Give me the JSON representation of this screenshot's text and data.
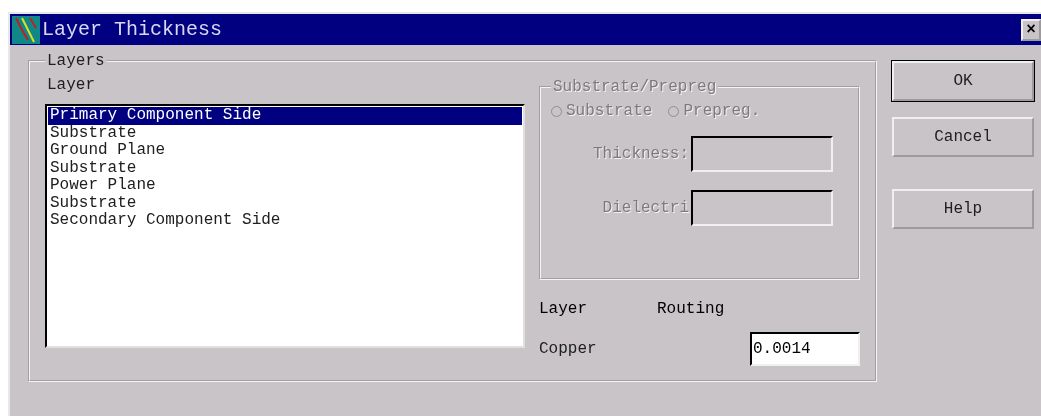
{
  "window": {
    "title": "Layer Thickness",
    "close": "×"
  },
  "layers_group": {
    "title": "Layers",
    "list_label": "Layer",
    "layers": [
      {
        "label": "Primary Component Side",
        "selected": true
      },
      {
        "label": "Substrate",
        "selected": false
      },
      {
        "label": "Ground Plane",
        "selected": false
      },
      {
        "label": "Substrate",
        "selected": false
      },
      {
        "label": "Power Plane",
        "selected": false
      },
      {
        "label": "Substrate",
        "selected": false
      },
      {
        "label": "Secondary Component Side",
        "selected": false
      }
    ],
    "substrate_group": {
      "title": "Substrate/Prepreg",
      "disabled": true,
      "options": [
        {
          "label": "Substrate",
          "checked": false
        },
        {
          "label": "Prepreg.",
          "checked": false
        }
      ],
      "fields": [
        {
          "label": "Thickness:"
        },
        {
          "label": "Dielectri"
        }
      ]
    },
    "column_headers": [
      "Layer",
      "Routing"
    ],
    "copper": {
      "label": "Copper",
      "value": "0.0014"
    }
  },
  "buttons": [
    {
      "label": "OK",
      "default": true
    },
    {
      "label": "Cancel",
      "default": false
    },
    {
      "label": "Help",
      "default": false
    }
  ]
}
